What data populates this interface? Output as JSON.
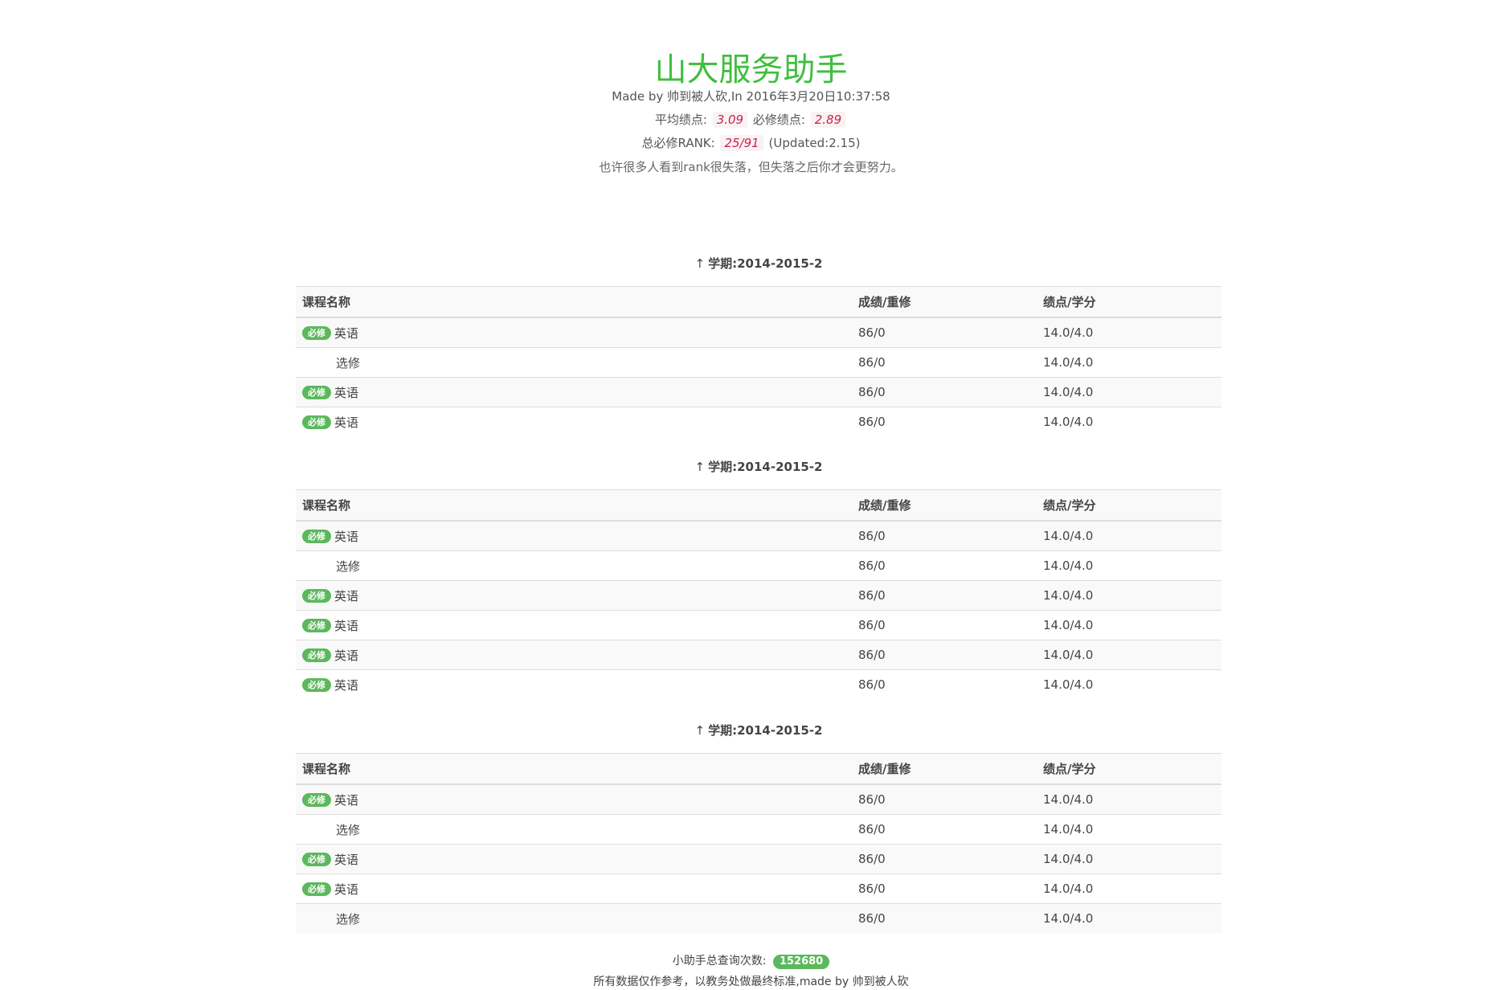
{
  "header": {
    "title": "山大服务助手",
    "made_by": "Made by 帅到被人砍,In 2016年3月20日10:37:58",
    "avg_gpa_label": "平均绩点:",
    "avg_gpa": "3.09",
    "req_gpa_label": "必修绩点:",
    "req_gpa": "2.89",
    "rank_label": "总必修RANK:",
    "rank": "25/91",
    "rank_updated": "(Updated:2.15)",
    "quote": "也许很多人看到rank很失落，但失落之后你才会更努力。"
  },
  "columns": {
    "course": "课程名称",
    "score": "成绩/重修",
    "gpa_credit": "绩点/学分"
  },
  "icons": {
    "term_arrow": "up-arrow-icon"
  },
  "colors": {
    "title": "#3fbf3f",
    "badge": "#5cb85c",
    "highlight_text": "#c7254e",
    "highlight_bg": "#f9f2f4"
  },
  "terms": [
    {
      "title": "学期:2014-2015-2",
      "rows": [
        {
          "badge": "必修",
          "course": "英语",
          "score": "86/0",
          "gpa_credit": "14.0/4.0"
        },
        {
          "badge": "",
          "course": "选修",
          "score": "86/0",
          "gpa_credit": "14.0/4.0"
        },
        {
          "badge": "必修",
          "course": "英语",
          "score": "86/0",
          "gpa_credit": "14.0/4.0"
        },
        {
          "badge": "必修",
          "course": "英语",
          "score": "86/0",
          "gpa_credit": "14.0/4.0"
        }
      ]
    },
    {
      "title": "学期:2014-2015-2",
      "rows": [
        {
          "badge": "必修",
          "course": "英语",
          "score": "86/0",
          "gpa_credit": "14.0/4.0"
        },
        {
          "badge": "",
          "course": "选修",
          "score": "86/0",
          "gpa_credit": "14.0/4.0"
        },
        {
          "badge": "必修",
          "course": "英语",
          "score": "86/0",
          "gpa_credit": "14.0/4.0"
        },
        {
          "badge": "必修",
          "course": "英语",
          "score": "86/0",
          "gpa_credit": "14.0/4.0"
        },
        {
          "badge": "必修",
          "course": "英语",
          "score": "86/0",
          "gpa_credit": "14.0/4.0"
        },
        {
          "badge": "必修",
          "course": "英语",
          "score": "86/0",
          "gpa_credit": "14.0/4.0"
        }
      ]
    },
    {
      "title": "学期:2014-2015-2",
      "rows": [
        {
          "badge": "必修",
          "course": "英语",
          "score": "86/0",
          "gpa_credit": "14.0/4.0"
        },
        {
          "badge": "",
          "course": "选修",
          "score": "86/0",
          "gpa_credit": "14.0/4.0"
        },
        {
          "badge": "必修",
          "course": "英语",
          "score": "86/0",
          "gpa_credit": "14.0/4.0"
        },
        {
          "badge": "必修",
          "course": "英语",
          "score": "86/0",
          "gpa_credit": "14.0/4.0"
        },
        {
          "badge": "",
          "course": "选修",
          "score": "86/0",
          "gpa_credit": "14.0/4.0"
        }
      ]
    }
  ],
  "footer": {
    "count_label": "小助手总查询次数:",
    "count": "152680",
    "note": "所有数据仅作参考，以教务处做最终标准,made by 帅到被人砍"
  }
}
